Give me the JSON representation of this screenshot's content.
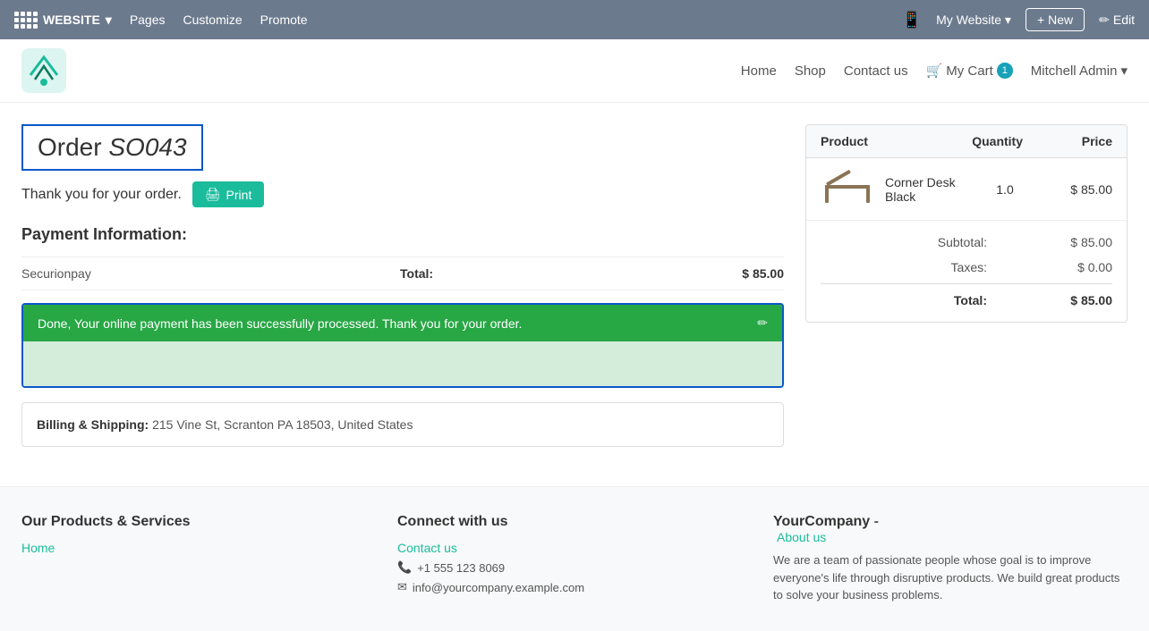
{
  "admin_bar": {
    "brand": "WEBSITE",
    "nav_items": [
      "Pages",
      "Customize",
      "Promote"
    ],
    "my_website": "My Website",
    "new_label": "New",
    "edit_label": "Edit",
    "mobile_icon": "📱"
  },
  "site_nav": {
    "home": "Home",
    "shop": "Shop",
    "contact_us": "Contact us",
    "cart_label": "My Cart",
    "cart_count": "1",
    "user": "Mitchell Admin"
  },
  "order": {
    "title_prefix": "Order ",
    "title_id": "SO043",
    "thank_you": "Thank you for your order.",
    "print_label": "Print",
    "payment_info_label": "Payment Information:",
    "payment_method": "Securionpay",
    "total_label": "Total:",
    "total_amount": "$ 85.00",
    "success_message": "Done, Your online payment has been successfully processed. Thank you for your order.",
    "billing_label": "Billing & Shipping:",
    "billing_address": "215 Vine St, Scranton PA 18503, United States"
  },
  "order_table": {
    "col_product": "Product",
    "col_quantity": "Quantity",
    "col_price": "Price",
    "rows": [
      {
        "name": "Corner Desk Black",
        "quantity": "1.0",
        "price": "$ 85.00"
      }
    ],
    "subtotal_label": "Subtotal:",
    "subtotal_value": "$ 85.00",
    "taxes_label": "Taxes:",
    "taxes_value": "$ 0.00",
    "total_label": "Total:",
    "total_value": "$ 85.00"
  },
  "footer": {
    "products_title": "Our Products & Services",
    "products_home": "Home",
    "connect_title": "Connect with us",
    "contact_link": "Contact us",
    "phone": "+1 555 123 8069",
    "email": "info@yourcompany.example.com",
    "company_title": "YourCompany",
    "about_us_link": "About us",
    "company_desc": "We are a team of passionate people whose goal is to improve everyone's life through disruptive products. We build great products to solve your business problems."
  }
}
